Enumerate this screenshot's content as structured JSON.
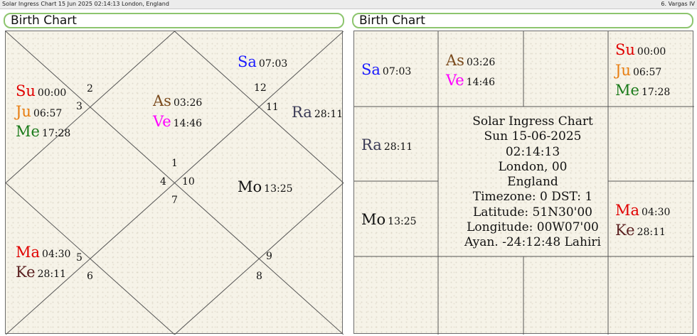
{
  "window": {
    "title": "Solar Ingress Chart 15 Jun 2025 02:14:13  London, England",
    "right_label": "6. Vargas IV"
  },
  "left_panel": {
    "header": "Birth Chart",
    "house_numbers": [
      "1",
      "2",
      "3",
      "4",
      "5",
      "6",
      "7",
      "8",
      "9",
      "10",
      "11",
      "12"
    ],
    "planets": [
      {
        "abbr": "Sa",
        "degree": "07:03",
        "color": "#1a1aff"
      },
      {
        "abbr": "Su",
        "degree": "00:00",
        "color": "#e00000"
      },
      {
        "abbr": "Ju",
        "degree": "06:57",
        "color": "#e87d10"
      },
      {
        "abbr": "Me",
        "degree": "17:28",
        "color": "#1a7a1a"
      },
      {
        "abbr": "As",
        "degree": "03:26",
        "color": "#7a4a1c"
      },
      {
        "abbr": "Ve",
        "degree": "14:46",
        "color": "#ff00ff"
      },
      {
        "abbr": "Ra",
        "degree": "28:11",
        "color": "#3a3a55"
      },
      {
        "abbr": "Mo",
        "degree": "13:25",
        "color": "#111111"
      },
      {
        "abbr": "Ma",
        "degree": "04:30",
        "color": "#e00000"
      },
      {
        "abbr": "Ke",
        "degree": "28:11",
        "color": "#5a1f1f"
      }
    ]
  },
  "right_panel": {
    "header": "Birth Chart",
    "planets": [
      {
        "abbr": "Sa",
        "degree": "07:03",
        "color": "#1a1aff"
      },
      {
        "abbr": "As",
        "degree": "03:26",
        "color": "#7a4a1c"
      },
      {
        "abbr": "Ve",
        "degree": "14:46",
        "color": "#ff00ff"
      },
      {
        "abbr": "Su",
        "degree": "00:00",
        "color": "#e00000"
      },
      {
        "abbr": "Ju",
        "degree": "06:57",
        "color": "#e87d10"
      },
      {
        "abbr": "Me",
        "degree": "17:28",
        "color": "#1a7a1a"
      },
      {
        "abbr": "Ra",
        "degree": "28:11",
        "color": "#3a3a55"
      },
      {
        "abbr": "Mo",
        "degree": "13:25",
        "color": "#111111"
      },
      {
        "abbr": "Ma",
        "degree": "04:30",
        "color": "#e00000"
      },
      {
        "abbr": "Ke",
        "degree": "28:11",
        "color": "#5a1f1f"
      }
    ],
    "center_info": [
      "Solar Ingress Chart",
      "Sun 15-06-2025",
      "02:14:13",
      "London, 00",
      "England",
      "Timezone: 0 DST: 1",
      "Latitude: 51N30'00",
      "Longitude: 00W07'00",
      "Ayan. -24:12:48 Lahiri"
    ]
  }
}
